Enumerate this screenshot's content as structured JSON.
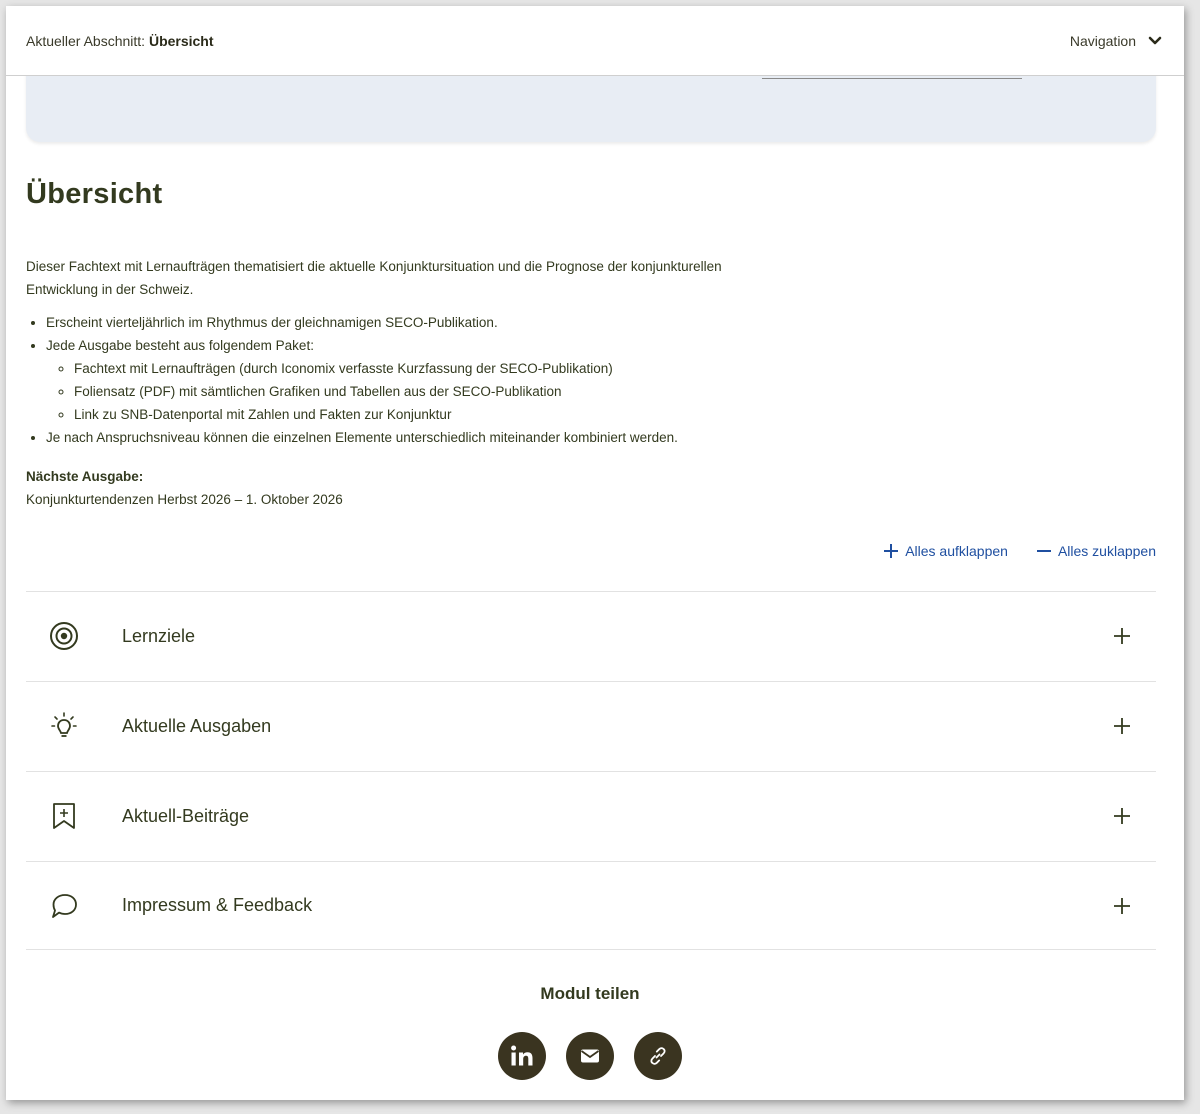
{
  "topbar": {
    "crumb_prefix": "Aktueller Abschnitt: ",
    "crumb_current": "Übersicht",
    "nav_label": "Navigation"
  },
  "overview": {
    "title": "Übersicht",
    "intro": "Dieser Fachtext mit Lernaufträgen thematisiert die aktuelle Konjunktursituation und die Prognose der konjunkturellen Entwicklung in der Schweiz.",
    "bullets": [
      "Erscheint vierteljährlich im Rhythmus der gleichnamigen SECO-Publikation.",
      "Jede Ausgabe besteht aus folgendem Paket:",
      "Je nach Anspruchsniveau können die einzelnen Elemente unterschiedlich miteinander kombiniert werden."
    ],
    "sub_bullets": [
      "Fachtext mit Lernaufträgen (durch Iconomix verfasste Kurzfassung der SECO-Publikation)",
      "Foliensatz (PDF) mit sämtlichen Grafiken und Tabellen aus der SECO-Publikation",
      "Link zu SNB-Datenportal mit Zahlen und Fakten zur Konjunktur"
    ],
    "next_label": "Nächste Ausgabe:",
    "next_value": "Konjunkturtendenzen Herbst 2026 – 1. Oktober 2026"
  },
  "controls": {
    "expand_all": "Alles aufklappen",
    "collapse_all": "Alles zuklappen"
  },
  "accordion": [
    {
      "label": "Lernziele",
      "icon": "target-icon"
    },
    {
      "label": "Aktuelle Ausgaben",
      "icon": "lightbulb-icon"
    },
    {
      "label": "Aktuell-Beiträge",
      "icon": "bookmark-plus-icon"
    },
    {
      "label": "Impressum & Feedback",
      "icon": "speech-bubble-icon"
    }
  ],
  "share": {
    "title": "Modul teilen",
    "buttons": [
      "linkedin-icon",
      "mail-icon",
      "link-icon"
    ]
  },
  "colors": {
    "text": "#333a1f",
    "link": "#1f4fa0",
    "share_button": "#3a3420",
    "card": "#e8edf4"
  }
}
